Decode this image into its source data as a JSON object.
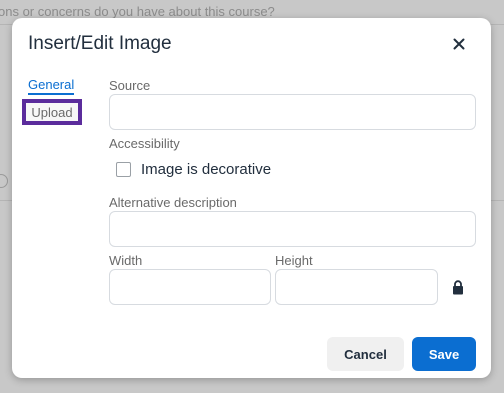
{
  "background": {
    "text": "ons or concerns do you have about this course?"
  },
  "dialog": {
    "title": "Insert/Edit Image",
    "close_icon": "close-icon"
  },
  "tabs": [
    {
      "label": "General",
      "active": true
    },
    {
      "label": "Upload",
      "active": false
    }
  ],
  "form": {
    "source_label": "Source",
    "source_value": "",
    "accessibility_label": "Accessibility",
    "decorative_label": "Image is decorative",
    "decorative_checked": false,
    "alt_label": "Alternative description",
    "alt_value": "",
    "width_label": "Width",
    "width_value": "",
    "height_label": "Height",
    "height_value": "",
    "constrain_icon": "lock-icon"
  },
  "buttons": {
    "cancel": "Cancel",
    "save": "Save"
  },
  "colors": {
    "accent": "#0b6ed1",
    "focus_highlight": "#5b2c9c"
  }
}
